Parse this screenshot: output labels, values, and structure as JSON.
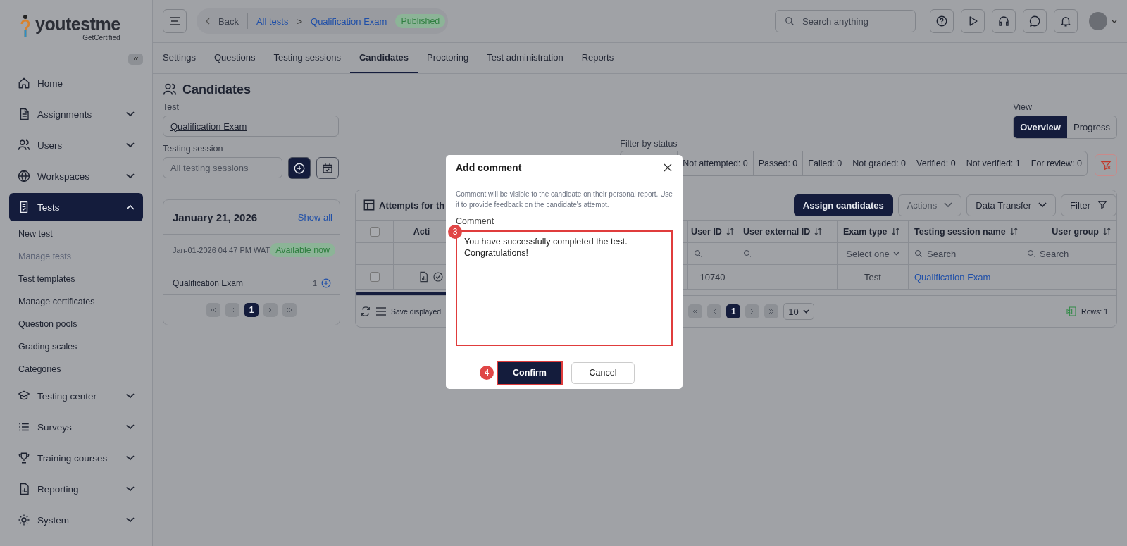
{
  "sidebar": {
    "logo": {
      "name": "youtestme",
      "tagline": "GetCertified"
    },
    "items": [
      {
        "label": "Home",
        "kind": "link",
        "selected": false
      },
      {
        "label": "Assignments",
        "kind": "group",
        "expanded": false,
        "selected": false
      },
      {
        "label": "Users",
        "kind": "group",
        "expanded": false,
        "selected": false
      },
      {
        "label": "Workspaces",
        "kind": "group",
        "expanded": false,
        "selected": false
      },
      {
        "label": "Tests",
        "kind": "group",
        "expanded": true,
        "selected": true,
        "children": [
          {
            "label": "New test",
            "selected": false
          },
          {
            "label": "Manage tests",
            "selected": true
          },
          {
            "label": "Test templates",
            "selected": false
          },
          {
            "label": "Manage certificates",
            "selected": false
          },
          {
            "label": "Question pools",
            "selected": false
          },
          {
            "label": "Grading scales",
            "selected": false
          },
          {
            "label": "Categories",
            "selected": false
          }
        ]
      },
      {
        "label": "Testing center",
        "kind": "group",
        "expanded": false,
        "selected": false
      },
      {
        "label": "Surveys",
        "kind": "group",
        "expanded": false,
        "selected": false
      },
      {
        "label": "Training courses",
        "kind": "group",
        "expanded": false,
        "selected": false
      },
      {
        "label": "Reporting",
        "kind": "group",
        "expanded": false,
        "selected": false
      },
      {
        "label": "System",
        "kind": "group",
        "expanded": false,
        "selected": false
      }
    ]
  },
  "topbar": {
    "back": "Back",
    "breadcrumb": [
      "All tests",
      "Qualification Exam"
    ],
    "separator": ">",
    "status": "Published",
    "search": {
      "placeholder": "Search anything"
    }
  },
  "tabs": [
    {
      "label": "Settings",
      "selected": false
    },
    {
      "label": "Questions",
      "selected": false
    },
    {
      "label": "Testing sessions",
      "selected": false
    },
    {
      "label": "Candidates",
      "selected": true
    },
    {
      "label": "Proctoring",
      "selected": false
    },
    {
      "label": "Test administration",
      "selected": false
    },
    {
      "label": "Reports",
      "selected": false
    }
  ],
  "page": {
    "title": "Candidates",
    "test_field": {
      "label": "Test",
      "value": "Qualification Exam"
    },
    "session_field": {
      "label": "Testing session",
      "placeholder": "All testing sessions"
    },
    "view": {
      "label": "View",
      "options": [
        {
          "label": "Overview",
          "selected": true
        },
        {
          "label": "Progress",
          "selected": false
        }
      ]
    },
    "status_filter": {
      "label": "Filter by status",
      "chips": [
        "Not attempted: 0",
        "Passed: 0",
        "Failed: 0",
        "Not graded: 0",
        "Verified: 0",
        "Not verified: 1",
        "For review: 0"
      ]
    }
  },
  "sessions_card": {
    "date": "January 21, 2026",
    "show_all": "Show all",
    "session_time": "Jan-01-2026 04:47 PM WAT",
    "session_status": "Available now",
    "test_name": "Qualification Exam",
    "test_count": "1",
    "pages": [
      {
        "label": "1",
        "selected": true
      }
    ]
  },
  "attempts": {
    "title": "Attempts for th",
    "buttons": [
      {
        "label": "Assign candidates",
        "kind": "primary",
        "disabled": false
      },
      {
        "label": "Actions",
        "kind": "dropdown",
        "disabled": true
      },
      {
        "label": "Data Transfer",
        "kind": "dropdown",
        "disabled": false
      },
      {
        "label": "Filter",
        "kind": "filter",
        "disabled": false
      }
    ],
    "header_checked": false,
    "columns": [
      {
        "label": "Acti"
      },
      {
        "label": "User ID",
        "sortable": true
      },
      {
        "label": "User external ID",
        "sortable": true
      },
      {
        "label": "Exam type",
        "sortable": true
      },
      {
        "label": "Testing session name",
        "sortable": true
      },
      {
        "label": "User group",
        "sortable": true
      }
    ],
    "filters": [
      {
        "kind": "none"
      },
      {
        "kind": "search"
      },
      {
        "kind": "search"
      },
      {
        "kind": "select",
        "placeholder": "Select one"
      },
      {
        "kind": "search",
        "placeholder": "Search"
      },
      {
        "kind": "search",
        "placeholder": "Search"
      }
    ],
    "rows": [
      {
        "checked": false,
        "user_id": "10740",
        "exam_type": "Test",
        "testing_session": "Qualification Exam"
      }
    ],
    "footer": {
      "save": "Save displayed",
      "pages": [
        {
          "label": "1",
          "selected": true
        }
      ],
      "per_page": "10",
      "rows": "Rows: 1"
    }
  },
  "modal": {
    "title": "Add comment",
    "description": "Comment will be visible to the candidate on their personal report. Use it to provide feedback on the candidate's attempt.",
    "field_label": "Comment",
    "value": "You have successfully completed the test.\nCongratulations!",
    "field_highlighted": true,
    "field_step": "3",
    "buttons": [
      {
        "label": "Confirm",
        "kind": "primary",
        "highlighted": true,
        "step": "4"
      },
      {
        "label": "Cancel",
        "kind": "secondary",
        "highlighted": false
      }
    ]
  }
}
